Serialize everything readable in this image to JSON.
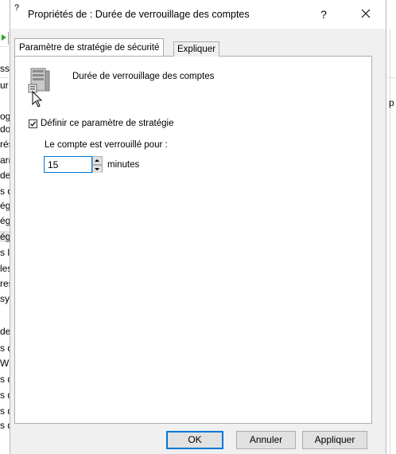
{
  "background": {
    "left_fragments": [
      "ssw",
      "ur",
      "ogi",
      "do",
      "rés",
      "arr",
      "de",
      "s d",
      "égi",
      "égi",
      "égi",
      "s lo",
      "les",
      "res",
      "sys",
      "de",
      "s d",
      "W",
      "s d",
      "s d",
      "s d",
      "s d"
    ],
    "right_fragment": "p"
  },
  "dialog": {
    "title_fragment": "?",
    "title": "Propriétés de : Durée de verrouillage des comptes",
    "help_label": "?",
    "tabs": [
      {
        "label": "Paramètre de stratégie de sécurité",
        "active": true
      },
      {
        "label": "Expliquer",
        "active": false
      }
    ],
    "policy_name": "Durée de verrouillage des comptes",
    "define_checkbox": {
      "label": "Définir ce paramètre de stratégie",
      "checked": true
    },
    "lockout_label": "Le compte est verrouillé pour :",
    "lockout_value": "15",
    "lockout_unit": "minutes",
    "buttons": {
      "ok": "OK",
      "cancel": "Annuler",
      "apply": "Appliquer"
    }
  },
  "icons": [
    "server-policy-icon",
    "mouse-cursor-icon",
    "close-icon",
    "checkmark-icon",
    "spin-up-icon",
    "spin-down-icon"
  ],
  "colors": {
    "focus_blue": "#0078d7",
    "dialog_bg": "#f0f0f0",
    "button_bg": "#e1e1e1",
    "border": "#adadad"
  }
}
